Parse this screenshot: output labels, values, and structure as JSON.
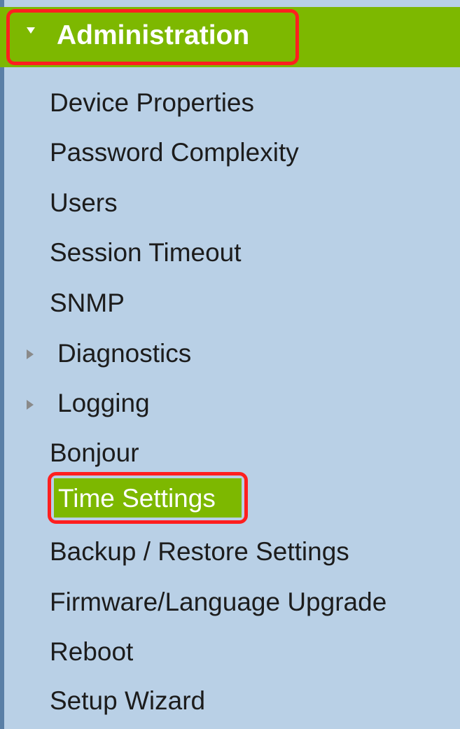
{
  "colors": {
    "panel_background": "#b9d0e6",
    "header_green": "#7db800",
    "highlight_red": "#ff1f1f",
    "text": "#1c1c1c",
    "active_text": "#ffffff"
  },
  "header": {
    "title": "Administration",
    "icon": "caret-down-icon"
  },
  "menu": {
    "items": [
      {
        "label": "Device Properties"
      },
      {
        "label": "Password Complexity"
      },
      {
        "label": "Users"
      },
      {
        "label": "Session Timeout"
      },
      {
        "label": "SNMP"
      },
      {
        "label": "Diagnostics",
        "icon": "caret-right-icon"
      },
      {
        "label": "Logging",
        "icon": "caret-right-icon"
      },
      {
        "label": "Bonjour"
      },
      {
        "label": "Time Settings",
        "active": true
      },
      {
        "label": "Backup / Restore Settings"
      },
      {
        "label": "Firmware/Language Upgrade"
      },
      {
        "label": "Reboot"
      },
      {
        "label": "Setup Wizard"
      }
    ]
  }
}
